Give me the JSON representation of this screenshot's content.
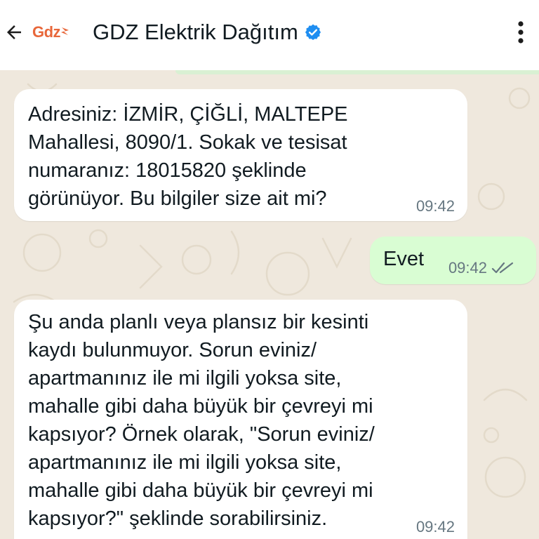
{
  "header": {
    "logo_text": "Gdz",
    "title": "GDZ Elektrik Dağıtım",
    "icons": {
      "back": "arrow-left-icon",
      "verified": "verified-badge-icon",
      "menu": "more-vertical-icon"
    }
  },
  "colors": {
    "logo": "#e8673a",
    "verified": "#1f8ef1",
    "chat_bg": "#efe8dd",
    "incoming_bubble": "#ffffff",
    "outgoing_bubble": "#d9fdd3",
    "timestamp": "#667781"
  },
  "messages": [
    {
      "direction": "incoming",
      "text": "Adresiniz: İZMİR, ÇİĞLİ, MALTEPE\nMahallesi, 8090/1. Sokak ve tesisat\nnumaranız: 18015820 şeklinde\ngörünüyor. Bu bilgiler size ait mi?",
      "time": "09:42"
    },
    {
      "direction": "outgoing",
      "text": "Evet",
      "time": "09:42",
      "status": "delivered"
    },
    {
      "direction": "incoming",
      "text": "Şu anda planlı veya plansız bir kesinti\nkaydı bulunmuyor. Sorun eviniz/\napartmanınız ile mi ilgili yoksa site,\nmahalle gibi daha büyük bir çevreyi mi\nkapsıyor? Örnek olarak, \"Sorun eviniz/\napartmanınız ile mi ilgili yoksa site,\nmahalle gibi daha büyük bir çevreyi mi\nkapsıyor?\" şeklinde sorabilirsiniz.",
      "time": "09:42"
    }
  ]
}
